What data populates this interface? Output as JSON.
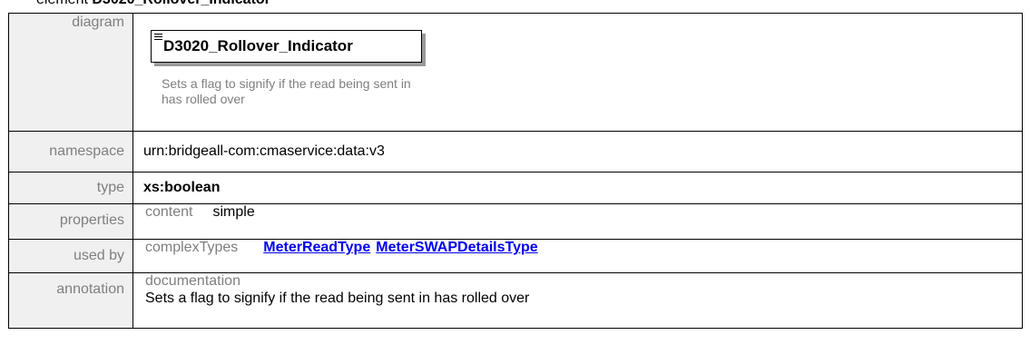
{
  "heading": {
    "prefix": "element",
    "name": "D3020_Rollover_Indicator"
  },
  "rows": {
    "diagram": {
      "label": "diagram",
      "element_name": "D3020_Rollover_Indicator",
      "description": "Sets a flag to signify if the read being sent in has rolled over"
    },
    "namespace": {
      "label": "namespace",
      "value": "urn:bridgeall-com:cmaservice:data:v3"
    },
    "type": {
      "label": "type",
      "value": "xs:boolean"
    },
    "properties": {
      "label": "properties",
      "key": "content",
      "value": "simple"
    },
    "used_by": {
      "label": "used by",
      "key": "complexTypes",
      "links": [
        "MeterReadType",
        "MeterSWAPDetailsType"
      ]
    },
    "annotation": {
      "label": "annotation",
      "key": "documentation",
      "text": "Sets a flag to signify if the read being sent in has rolled over"
    }
  }
}
